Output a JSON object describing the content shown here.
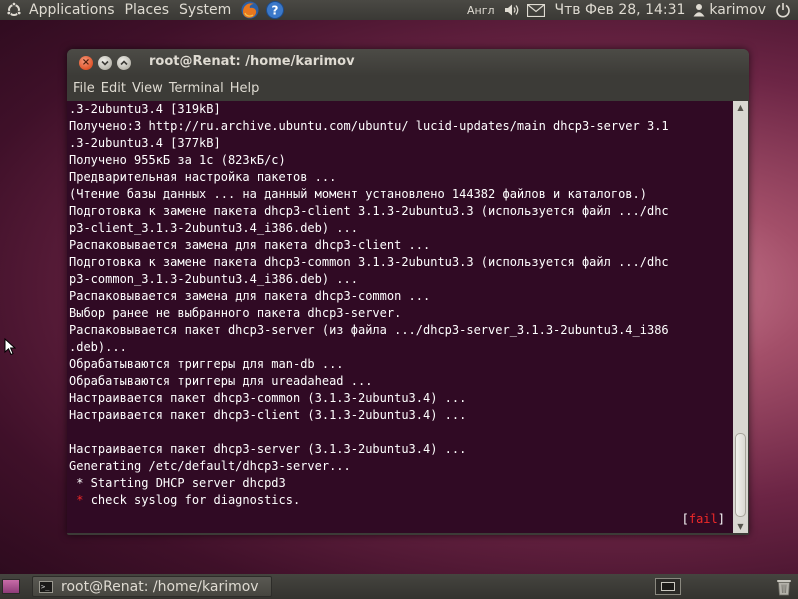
{
  "top_panel": {
    "menus": [
      "Applications",
      "Places",
      "System"
    ],
    "keyboard_layout": "Англ",
    "clock": "Чтв Фев 28, 14:31",
    "user": "karimov"
  },
  "window": {
    "title": "root@Renat: /home/karimov",
    "menu": [
      "File",
      "Edit",
      "View",
      "Terminal",
      "Help"
    ]
  },
  "terminal": {
    "lines": [
      ".3-2ubuntu3.4 [319kB]",
      "Получено:3 http://ru.archive.ubuntu.com/ubuntu/ lucid-updates/main dhcp3-server 3.1",
      ".3-2ubuntu3.4 [377kB]",
      "Получено 955кБ за 1с (823кБ/c)",
      "Предварительная настройка пакетов ...",
      "(Чтение базы данных ... на данный момент установлено 144382 файлов и каталогов.)",
      "Подготовка к замене пакета dhcp3-client 3.1.3-2ubuntu3.3 (используется файл .../dhc",
      "p3-client_3.1.3-2ubuntu3.4_i386.deb) ...",
      "Распаковывается замена для пакета dhcp3-client ...",
      "Подготовка к замене пакета dhcp3-common 3.1.3-2ubuntu3.3 (используется файл .../dhc",
      "p3-common_3.1.3-2ubuntu3.4_i386.deb) ...",
      "Распаковывается замена для пакета dhcp3-common ...",
      "Выбор ранее не выбранного пакета dhcp3-server.",
      "Распаковывается пакет dhcp3-server (из файла .../dhcp3-server_3.1.3-2ubuntu3.4_i386",
      ".deb)...",
      "Обрабатываются триггеры для man-db ...",
      "Обрабатываются триггеры для ureadahead ...",
      "Настраивается пакет dhcp3-common (3.1.3-2ubuntu3.4) ...",
      "Настраивается пакет dhcp3-client (3.1.3-2ubuntu3.4) ...",
      "",
      "Настраивается пакет dhcp3-server (3.1.3-2ubuntu3.4) ...",
      "Generating /etc/default/dhcp3-server...",
      " * Starting DHCP server dhcpd3"
    ],
    "error_bullet": "*",
    "error_text": " check syslog for diagnostics.",
    "status_open": "[",
    "status_word": "fail",
    "status_close": "]"
  },
  "bottom_panel": {
    "task_label": "root@Renat: /home/karimov"
  },
  "colors": {
    "terminal_bg": "#300a24",
    "error_red": "#ef2929",
    "panel_bg": "#3c3b37"
  }
}
